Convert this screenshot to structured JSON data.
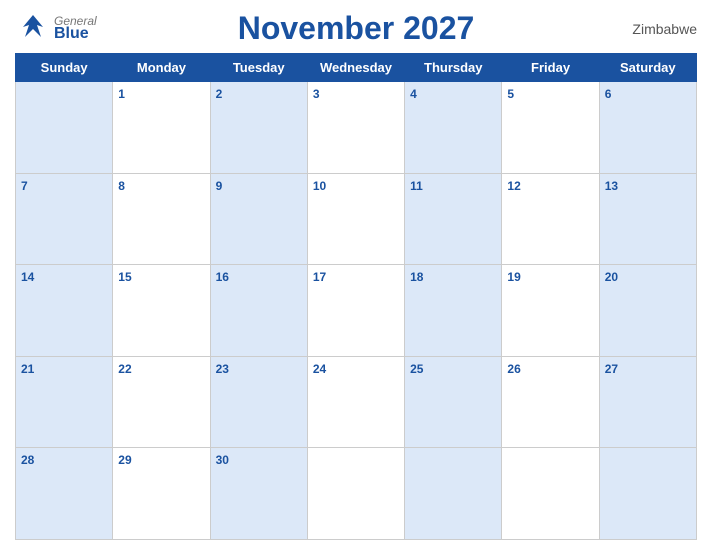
{
  "header": {
    "logo_general": "General",
    "logo_blue": "Blue",
    "title": "November 2027",
    "country": "Zimbabwe"
  },
  "days_of_week": [
    "Sunday",
    "Monday",
    "Tuesday",
    "Wednesday",
    "Thursday",
    "Friday",
    "Saturday"
  ],
  "weeks": [
    [
      {
        "num": "",
        "bg": "blue"
      },
      {
        "num": "1",
        "bg": "white"
      },
      {
        "num": "2",
        "bg": "blue"
      },
      {
        "num": "3",
        "bg": "white"
      },
      {
        "num": "4",
        "bg": "blue"
      },
      {
        "num": "5",
        "bg": "white"
      },
      {
        "num": "6",
        "bg": "blue"
      }
    ],
    [
      {
        "num": "7",
        "bg": "blue"
      },
      {
        "num": "8",
        "bg": "white"
      },
      {
        "num": "9",
        "bg": "blue"
      },
      {
        "num": "10",
        "bg": "white"
      },
      {
        "num": "11",
        "bg": "blue"
      },
      {
        "num": "12",
        "bg": "white"
      },
      {
        "num": "13",
        "bg": "blue"
      }
    ],
    [
      {
        "num": "14",
        "bg": "blue"
      },
      {
        "num": "15",
        "bg": "white"
      },
      {
        "num": "16",
        "bg": "blue"
      },
      {
        "num": "17",
        "bg": "white"
      },
      {
        "num": "18",
        "bg": "blue"
      },
      {
        "num": "19",
        "bg": "white"
      },
      {
        "num": "20",
        "bg": "blue"
      }
    ],
    [
      {
        "num": "21",
        "bg": "blue"
      },
      {
        "num": "22",
        "bg": "white"
      },
      {
        "num": "23",
        "bg": "blue"
      },
      {
        "num": "24",
        "bg": "white"
      },
      {
        "num": "25",
        "bg": "blue"
      },
      {
        "num": "26",
        "bg": "white"
      },
      {
        "num": "27",
        "bg": "blue"
      }
    ],
    [
      {
        "num": "28",
        "bg": "blue"
      },
      {
        "num": "29",
        "bg": "white"
      },
      {
        "num": "30",
        "bg": "blue"
      },
      {
        "num": "",
        "bg": "white"
      },
      {
        "num": "",
        "bg": "blue"
      },
      {
        "num": "",
        "bg": "white"
      },
      {
        "num": "",
        "bg": "blue"
      }
    ]
  ]
}
